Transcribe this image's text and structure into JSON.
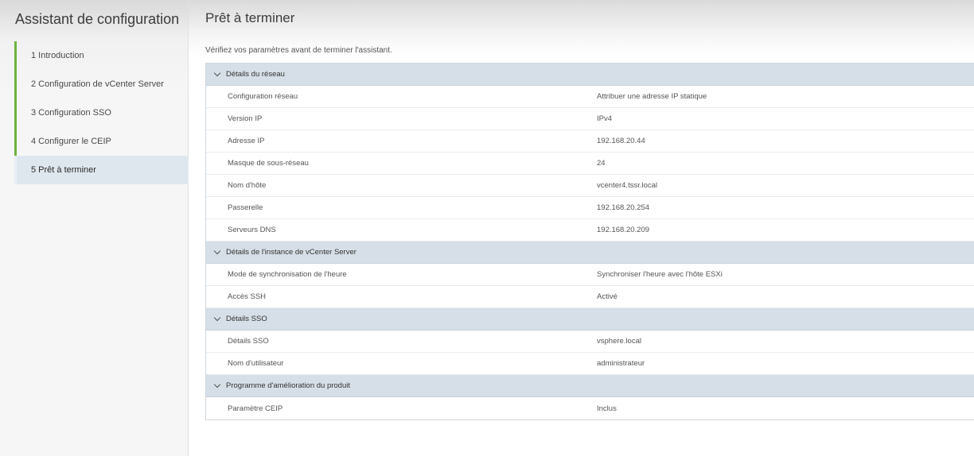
{
  "sidebar": {
    "title": "Assistant de configuration",
    "steps": [
      {
        "label": "1  Introduction"
      },
      {
        "label": "2  Configuration de vCenter Server"
      },
      {
        "label": "3  Configuration SSO"
      },
      {
        "label": "4  Configurer le CEIP"
      },
      {
        "label": "5  Prêt à terminer"
      }
    ]
  },
  "main": {
    "title": "Prêt à terminer",
    "subtitle": "Vérifiez vos paramètres avant de terminer l'assistant.",
    "sections": [
      {
        "header": "Détails du réseau",
        "rows": [
          {
            "label": "Configuration réseau",
            "value": "Attribuer une adresse IP statique"
          },
          {
            "label": "Version IP",
            "value": "IPv4"
          },
          {
            "label": "Adresse IP",
            "value": "192.168.20.44"
          },
          {
            "label": "Masque de sous-réseau",
            "value": "24"
          },
          {
            "label": "Nom d'hôte",
            "value": "vcenter4.tssr.local"
          },
          {
            "label": "Passerelle",
            "value": "192.168.20.254"
          },
          {
            "label": "Serveurs DNS",
            "value": "192.168.20.209"
          }
        ]
      },
      {
        "header": "Détails de l'instance de vCenter Server",
        "rows": [
          {
            "label": "Mode de synchronisation de l'heure",
            "value": "Synchroniser l'heure avec l'hôte ESXi"
          },
          {
            "label": "Accès SSH",
            "value": "Activé"
          }
        ]
      },
      {
        "header": "Détails SSO",
        "rows": [
          {
            "label": "Détails SSO",
            "value": "vsphere.local"
          },
          {
            "label": "Nom d'utilisateur",
            "value": "administrateur"
          }
        ]
      },
      {
        "header": "Programme d'amélioration du produit",
        "rows": [
          {
            "label": "Paramètre CEIP",
            "value": "Inclus"
          }
        ]
      }
    ]
  },
  "colors": {
    "step_accent": "#6db33f",
    "section_header_bg": "#d6dfe7",
    "active_step_bg": "#dfe7ee"
  }
}
